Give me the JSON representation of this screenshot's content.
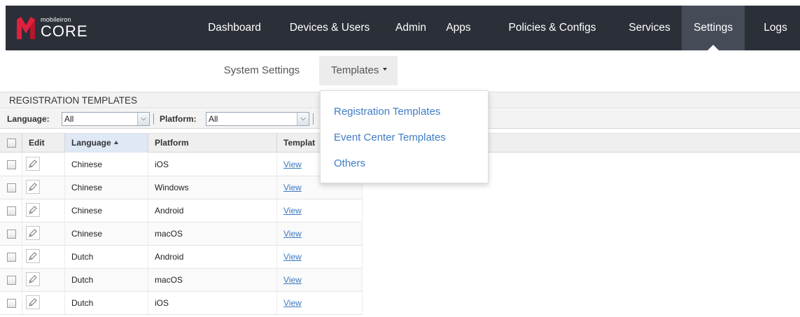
{
  "brand": {
    "small": "mobileiron",
    "big": "CORE"
  },
  "topnav": [
    {
      "label": "Dashboard",
      "active": false
    },
    {
      "label": "Devices & Users",
      "active": false
    },
    {
      "label": "Admin",
      "active": false
    },
    {
      "label": "Apps",
      "active": false
    },
    {
      "label": "Policies & Configs",
      "active": false
    },
    {
      "label": "Services",
      "active": false
    },
    {
      "label": "Settings",
      "active": true
    },
    {
      "label": "Logs",
      "active": false
    }
  ],
  "subnav": {
    "system_settings": "System Settings",
    "templates": "Templates"
  },
  "panel": {
    "title": "REGISTRATION TEMPLATES"
  },
  "filters": {
    "language_label": "Language:",
    "language_value": "All",
    "platform_label": "Platform:",
    "platform_value": "All"
  },
  "table": {
    "columns": {
      "edit": "Edit",
      "language": "Language",
      "platform": "Platform",
      "template": "Templat"
    },
    "rows": [
      {
        "language": "Chinese",
        "platform": "iOS",
        "link": "View"
      },
      {
        "language": "Chinese",
        "platform": "Windows",
        "link": "View"
      },
      {
        "language": "Chinese",
        "platform": "Android",
        "link": "View"
      },
      {
        "language": "Chinese",
        "platform": "macOS",
        "link": "View"
      },
      {
        "language": "Dutch",
        "platform": "Android",
        "link": "View"
      },
      {
        "language": "Dutch",
        "platform": "macOS",
        "link": "View"
      },
      {
        "language": "Dutch",
        "platform": "iOS",
        "link": "View"
      }
    ]
  },
  "templates_menu": [
    "Registration Templates",
    "Event Center Templates",
    "Others"
  ],
  "colors": {
    "nav_bg": "#2b2f38",
    "nav_active": "#454b57",
    "brand_red": "#e2203c",
    "link": "#3a78c2"
  }
}
